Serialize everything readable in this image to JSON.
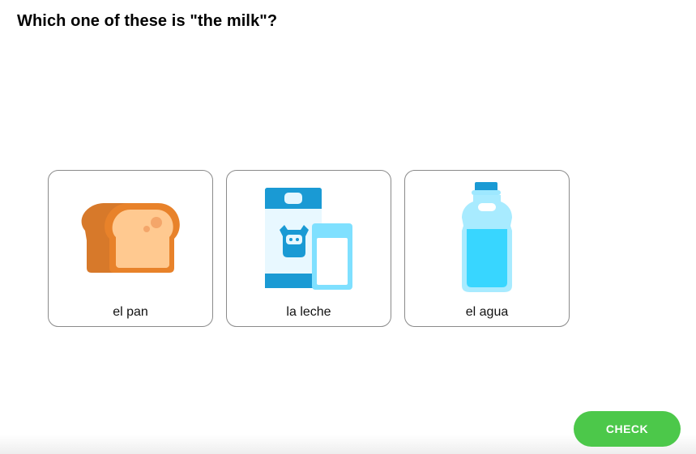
{
  "prompt": {
    "question": "Which one of these is \"the milk\"?"
  },
  "choices": [
    {
      "label": "el pan",
      "icon": "bread-icon"
    },
    {
      "label": "la leche",
      "icon": "milk-carton-icon"
    },
    {
      "label": "el agua",
      "icon": "water-bottle-icon"
    }
  ],
  "footer": {
    "check_label": "CHECK"
  },
  "colors": {
    "check_button": "#4cc84a",
    "card_border": "#8a8a8a",
    "bread_crust": "#e07b23",
    "bread_inner": "#ffc78a",
    "milk_blue": "#1fa1d8",
    "water_blue": "#3fd6ff"
  }
}
